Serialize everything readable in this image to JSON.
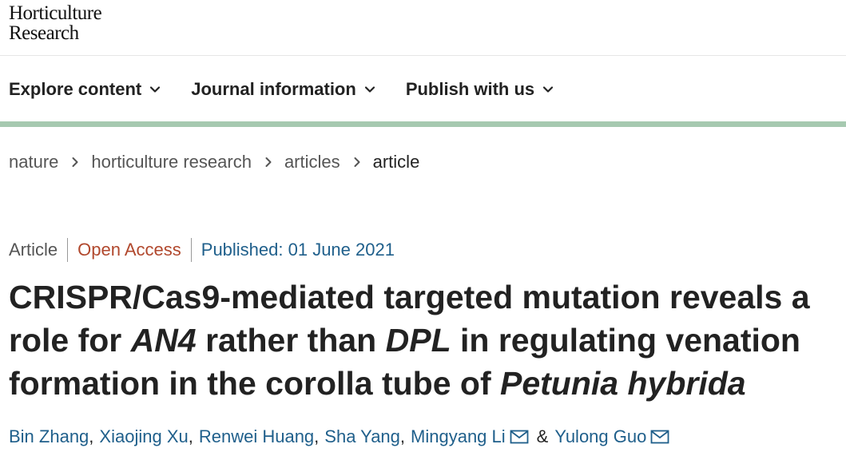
{
  "brand": {
    "line1": "Horticulture",
    "line2": "Research"
  },
  "nav": {
    "items": [
      {
        "label": "Explore content",
        "icon": "chevron-down-icon"
      },
      {
        "label": "Journal information",
        "icon": "chevron-down-icon"
      },
      {
        "label": "Publish with us",
        "icon": "chevron-down-icon"
      }
    ]
  },
  "breadcrumb": {
    "items": [
      "nature",
      "horticulture research",
      "articles"
    ],
    "current": "article",
    "separator_icon": "chevron-right-icon"
  },
  "article": {
    "type": "Article",
    "access": "Open Access",
    "published": "Published: 01 June 2021",
    "title": {
      "line1": "CRISPR/Cas9-mediated targeted mutation reveals a",
      "line2_pre": "role for ",
      "line2_gene1": "AN4",
      "line2_mid": " rather than ",
      "line2_gene2": "DPL",
      "line2_post": " in regulating venation",
      "line3_pre": "formation in the corolla tube of ",
      "line3_species": "Petunia hybrida"
    },
    "authors": [
      {
        "name": "Bin Zhang",
        "sep": ","
      },
      {
        "name": "Xiaojing Xu",
        "sep": ","
      },
      {
        "name": "Renwei Huang",
        "sep": ","
      },
      {
        "name": "Sha Yang",
        "sep": ","
      },
      {
        "name": "Mingyang Li",
        "sep": ""
      },
      {
        "name": "Yulong Guo",
        "sep": ""
      }
    ],
    "author_conjunction": "&",
    "corresponding_icon": "mail-icon"
  },
  "colors": {
    "accent_green": "#a6c9b0",
    "link_blue": "#1f5f8b",
    "open_access": "#b1482d"
  }
}
